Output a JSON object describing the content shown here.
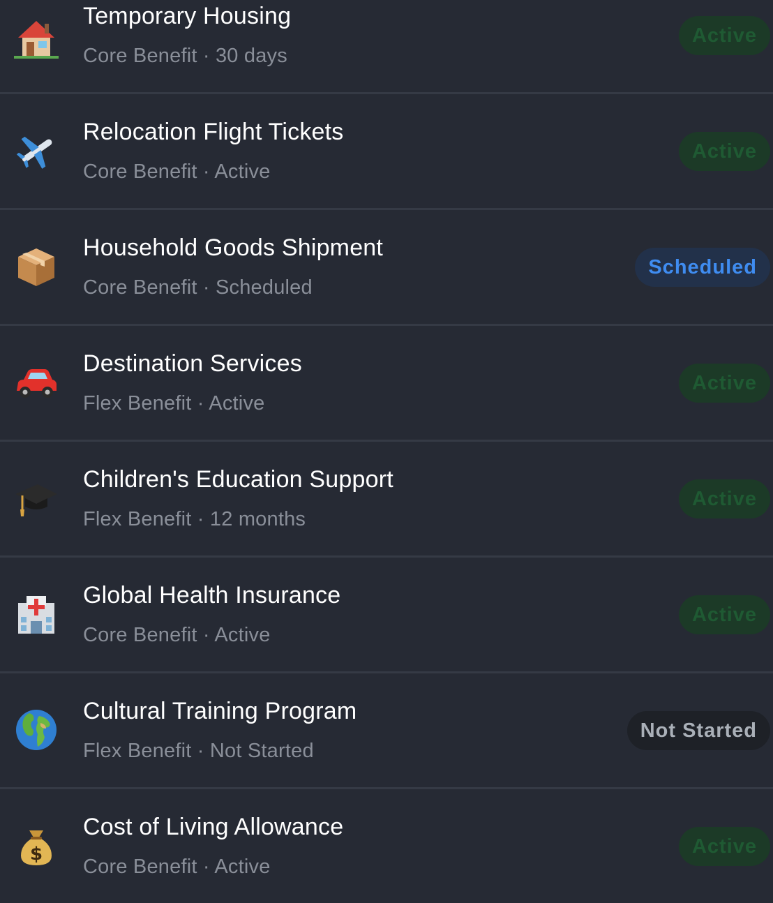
{
  "colors": {
    "background": "#262a34",
    "divider": "#353a45",
    "title": "#ffffff",
    "subtitle": "#8a8f99",
    "active_badge_bg": "#1c3a27",
    "active_badge_text": "#1f5a33",
    "scheduled_badge_bg": "#22314a",
    "scheduled_badge_text": "#3f8cf0",
    "notstarted_badge_bg": "#1e2127",
    "notstarted_badge_text": "#aab0b8"
  },
  "benefits": [
    {
      "icon": "house-icon",
      "title": "Temporary Housing",
      "subtitle": "Core Benefit · 30 days",
      "status": "Active",
      "status_type": "active"
    },
    {
      "icon": "airplane-icon",
      "title": "Relocation Flight Tickets",
      "subtitle": "Core Benefit · Active",
      "status": "Active",
      "status_type": "active"
    },
    {
      "icon": "package-icon",
      "title": "Household Goods Shipment",
      "subtitle": "Core Benefit · Scheduled",
      "status": "Scheduled",
      "status_type": "scheduled"
    },
    {
      "icon": "car-icon",
      "title": "Destination Services",
      "subtitle": "Flex Benefit · Active",
      "status": "Active",
      "status_type": "active"
    },
    {
      "icon": "graduation-cap-icon",
      "title": "Children's Education Support",
      "subtitle": "Flex Benefit · 12 months",
      "status": "Active",
      "status_type": "active"
    },
    {
      "icon": "hospital-icon",
      "title": "Global Health Insurance",
      "subtitle": "Core Benefit · Active",
      "status": "Active",
      "status_type": "active"
    },
    {
      "icon": "globe-icon",
      "title": "Cultural Training Program",
      "subtitle": "Flex Benefit · Not Started",
      "status": "Not Started",
      "status_type": "notstarted"
    },
    {
      "icon": "money-bag-icon",
      "title": "Cost of Living Allowance",
      "subtitle": "Core Benefit · Active",
      "status": "Active",
      "status_type": "active"
    }
  ]
}
